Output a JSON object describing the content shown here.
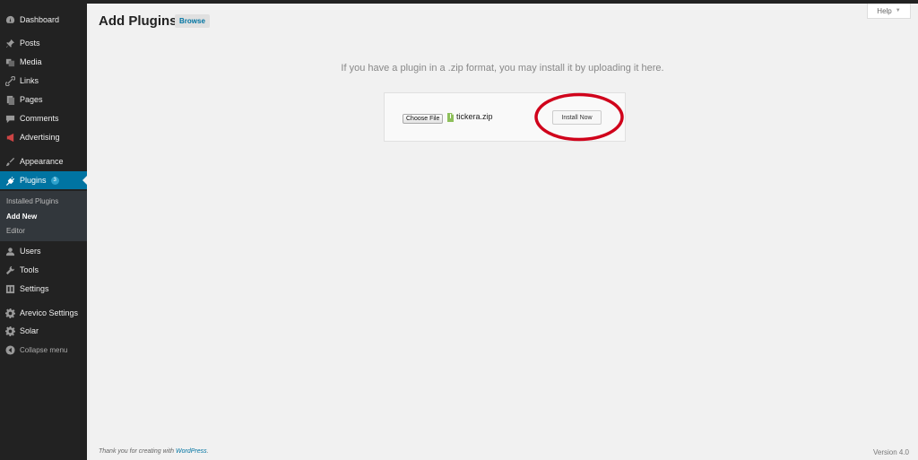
{
  "sidebar": {
    "items": [
      {
        "label": "Dashboard",
        "icon": "dashboard-icon"
      },
      {
        "label": "Posts",
        "icon": "pin-icon"
      },
      {
        "label": "Media",
        "icon": "media-icon"
      },
      {
        "label": "Links",
        "icon": "link-icon"
      },
      {
        "label": "Pages",
        "icon": "pages-icon"
      },
      {
        "label": "Comments",
        "icon": "comment-icon"
      },
      {
        "label": "Advertising",
        "icon": "megaphone-icon"
      },
      {
        "label": "Appearance",
        "icon": "brush-icon"
      },
      {
        "label": "Plugins",
        "icon": "plug-icon",
        "badge": "3",
        "active": true
      },
      {
        "label": "Users",
        "icon": "user-icon"
      },
      {
        "label": "Tools",
        "icon": "wrench-icon"
      },
      {
        "label": "Settings",
        "icon": "settings-icon"
      },
      {
        "label": "Arevico Settings",
        "icon": "gear-icon"
      },
      {
        "label": "Solar",
        "icon": "gear-icon"
      },
      {
        "label": "Collapse menu",
        "icon": "collapse-icon"
      }
    ],
    "submenu": [
      {
        "label": "Installed Plugins"
      },
      {
        "label": "Add New",
        "current": true
      },
      {
        "label": "Editor"
      }
    ],
    "active_color": "#0074a2",
    "background_color": "#222222"
  },
  "header": {
    "title": "Add Plugins",
    "browse_label": "Browse",
    "help_label": "Help"
  },
  "upload": {
    "instructions": "If you have a plugin in a .zip format, you may install it by uploading it here.",
    "choose_file_label": "Choose File",
    "file_name": "tickera.zip",
    "install_label": "Install Now",
    "highlight_color": "#d0021b"
  },
  "footer": {
    "thanks_prefix": "Thank you for creating with ",
    "wordpress_link": "WordPress",
    "thanks_suffix": ".",
    "version": "Version 4.0"
  }
}
